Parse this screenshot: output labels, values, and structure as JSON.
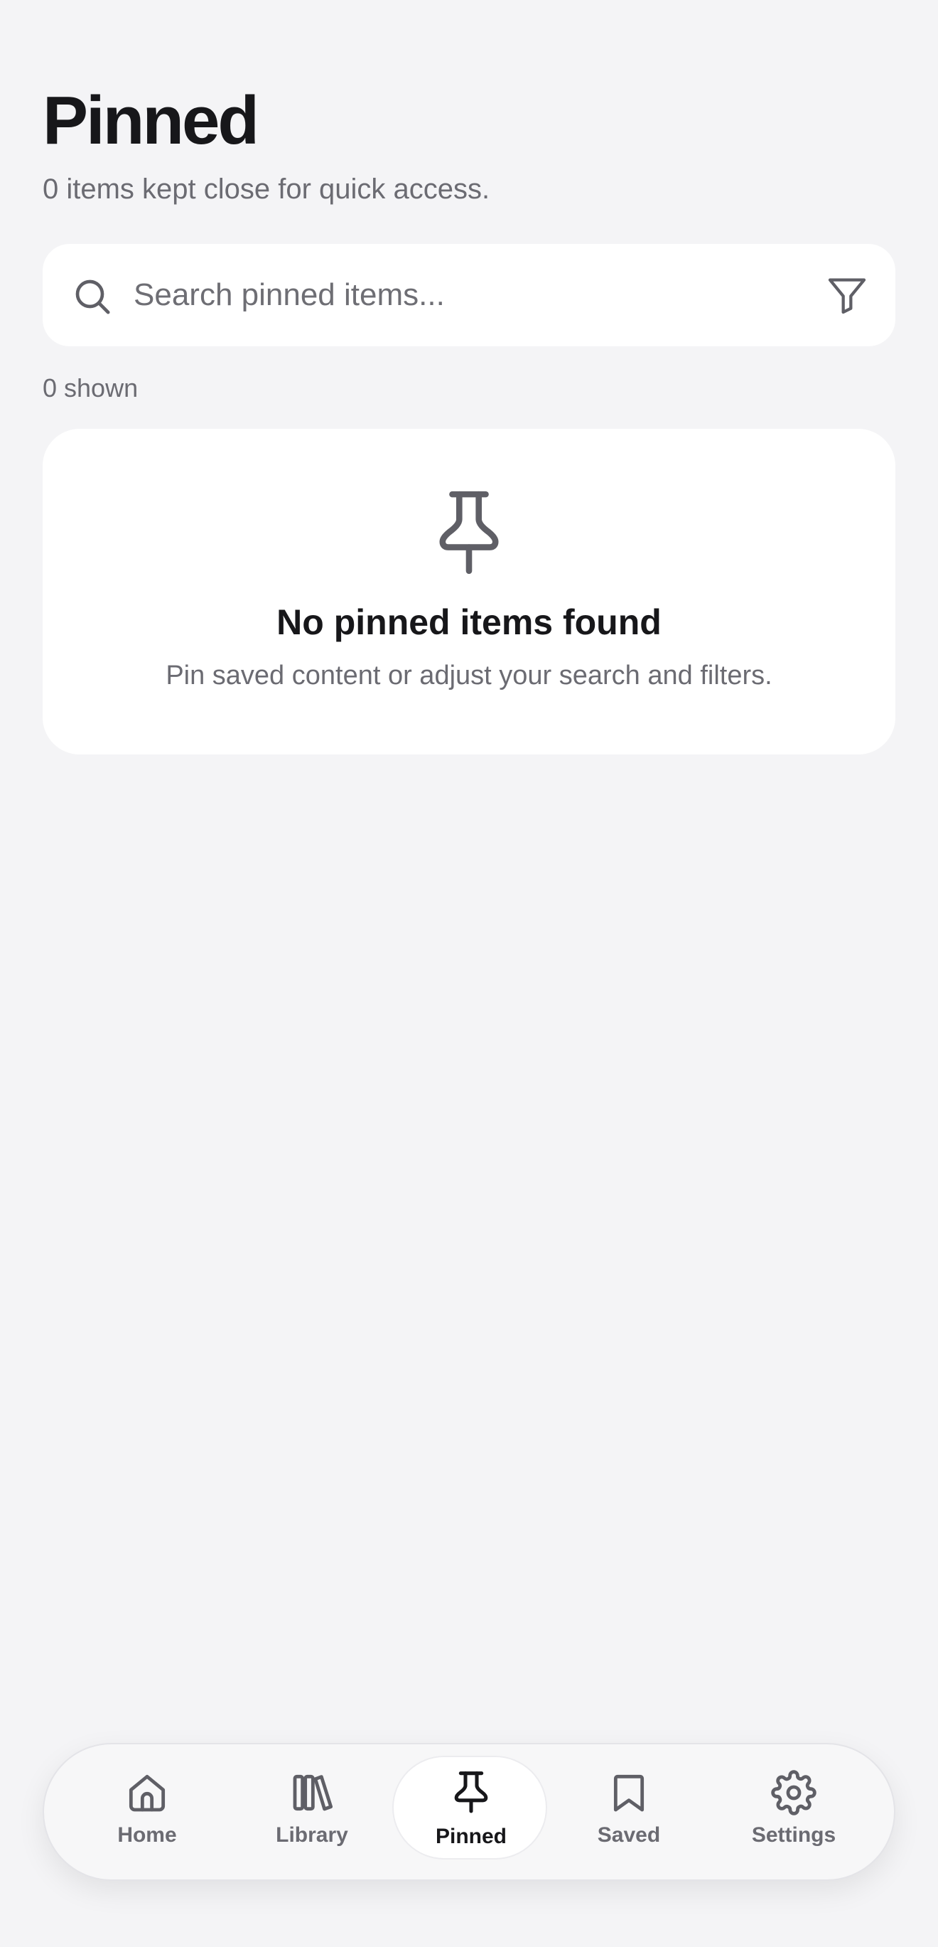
{
  "header": {
    "title": "Pinned",
    "subtitle": "0 items kept close for quick access."
  },
  "search": {
    "placeholder": "Search pinned items...",
    "value": ""
  },
  "results": {
    "count_label": "0 shown"
  },
  "empty_state": {
    "icon": "pin-icon",
    "title": "No pinned items found",
    "description": "Pin saved content or adjust your search and filters."
  },
  "tab_bar": {
    "active": "Pinned",
    "tabs": [
      {
        "label": "Home",
        "icon": "home-icon"
      },
      {
        "label": "Library",
        "icon": "library-icon"
      },
      {
        "label": "Pinned",
        "icon": "pin-icon"
      },
      {
        "label": "Saved",
        "icon": "bookmark-icon"
      },
      {
        "label": "Settings",
        "icon": "gear-icon"
      }
    ]
  },
  "colors": {
    "background": "#f4f4f6",
    "card": "#ffffff",
    "text_primary": "#17171a",
    "text_secondary": "#6b6b72",
    "icon": "#5f5f66"
  }
}
